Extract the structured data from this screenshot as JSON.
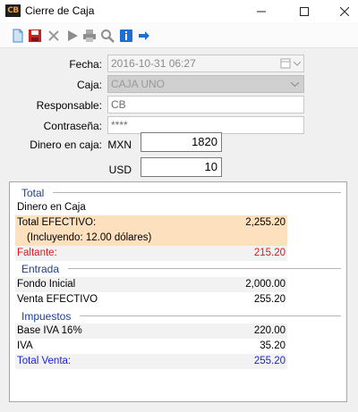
{
  "window": {
    "title": "Cierre de Caja",
    "app_icon_text": "CB"
  },
  "form": {
    "fecha_label": "Fecha:",
    "fecha_value": "2016-10-31 06:27",
    "caja_label": "Caja:",
    "caja_value": "CAJA UNO",
    "responsable_label": "Responsable:",
    "responsable_value": "CB",
    "password_label": "Contraseña:",
    "password_value": "****",
    "cash_label": "Dinero en caja:",
    "mxn_label": "MXN",
    "mxn_value": "1820",
    "usd_label": "USD",
    "usd_value": "10"
  },
  "summary": {
    "total": {
      "title": "Total",
      "rows": [
        {
          "label": "Dinero en Caja",
          "value": ""
        },
        {
          "label": "Total EFECTIVO:",
          "value": "2,255.20"
        },
        {
          "label": "(Incluyendo: 12.00 dólares)",
          "value": ""
        },
        {
          "label": "Faltante:",
          "value": "215.20"
        }
      ]
    },
    "entrada": {
      "title": "Entrada",
      "rows": [
        {
          "label": "Fondo Inicial",
          "value": "2,000.00"
        },
        {
          "label": "Venta EFECTIVO",
          "value": "255.20"
        }
      ]
    },
    "impuestos": {
      "title": "Impuestos",
      "rows": [
        {
          "label": "Base IVA 16%",
          "value": "220.00"
        },
        {
          "label": "IVA",
          "value": "35.20"
        },
        {
          "label": "Total Venta:",
          "value": "255.20"
        }
      ]
    }
  },
  "colors": {
    "section_title": "#1c3f94",
    "highlight": "#fde0be",
    "shortfall": "#e0141e",
    "total_sale": "#1a22e0"
  }
}
